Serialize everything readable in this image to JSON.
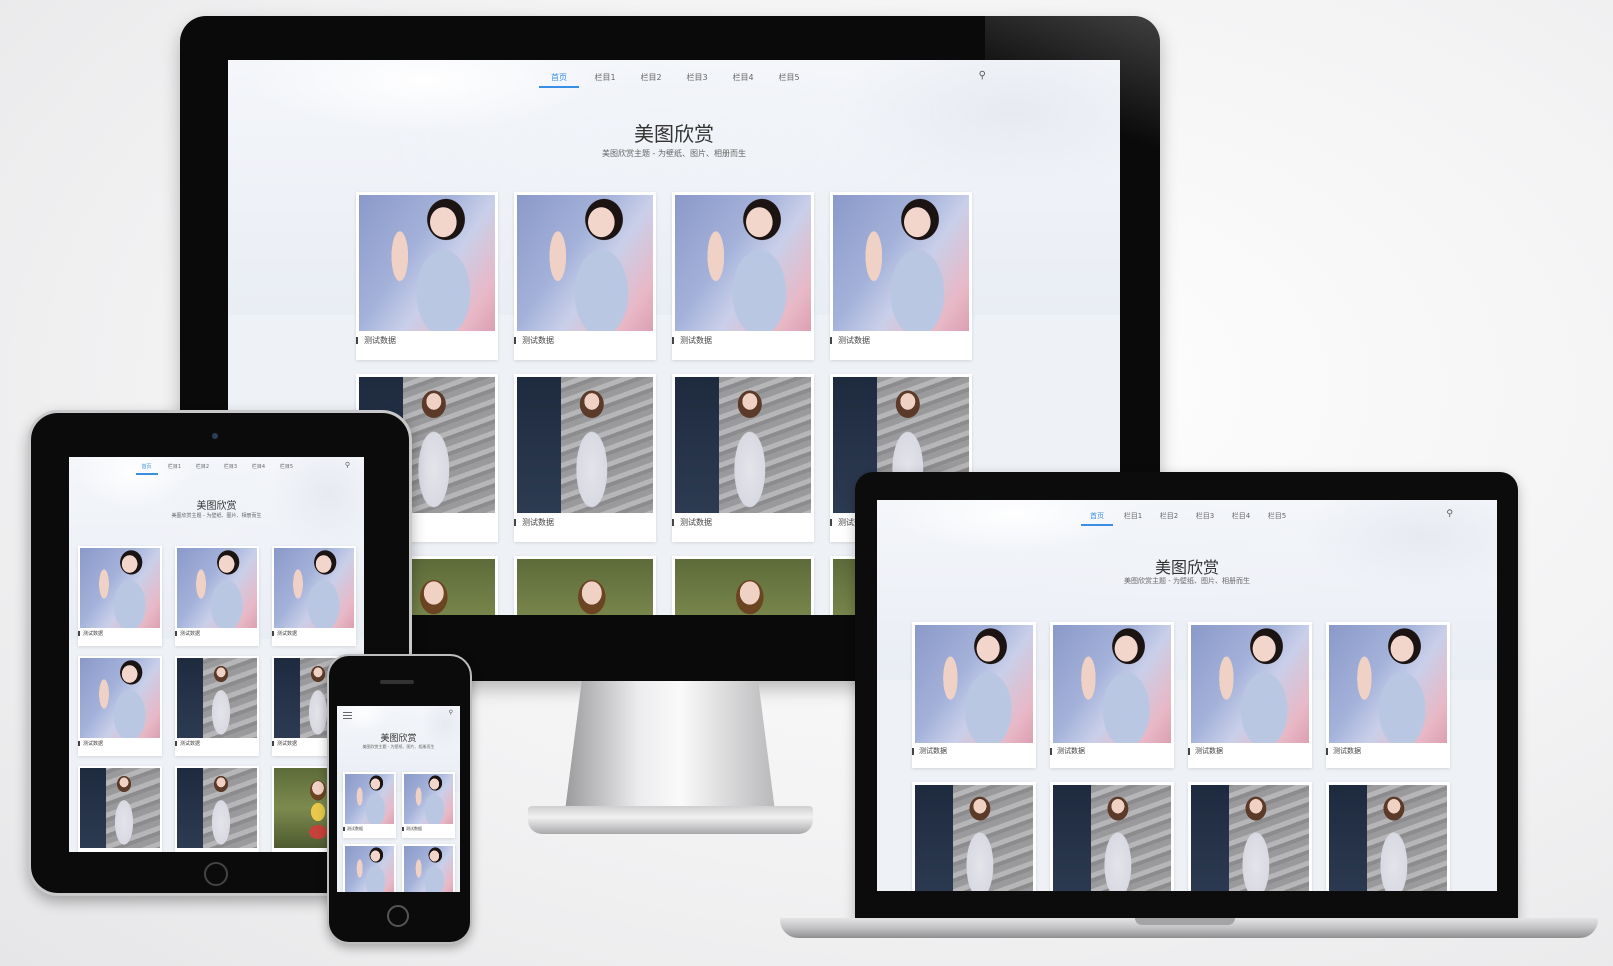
{
  "site": {
    "nav_items": [
      "首页",
      "栏目1",
      "栏目2",
      "栏目3",
      "栏目4",
      "栏目5"
    ],
    "active_nav": "首页",
    "title": "美图欣赏",
    "subtitle": "美图欣赏主题 - 为壁纸、图片、相册而生",
    "card_caption": "测试数据"
  },
  "icons": {
    "search": "search-icon",
    "menu": "menu-icon",
    "accent_color": "#3a8ee6"
  }
}
